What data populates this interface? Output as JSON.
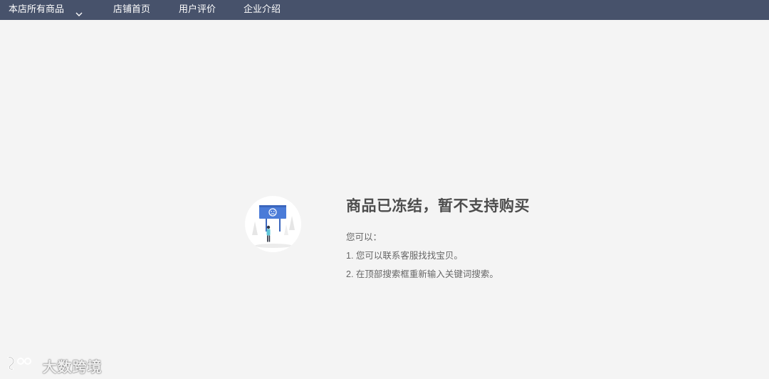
{
  "nav": {
    "all_products": "本店所有商品",
    "store_home": "店铺首页",
    "user_reviews": "用户评价",
    "company_intro": "企业介绍"
  },
  "message": {
    "title": "商品已冻结，暂不支持购买",
    "hint": "您可以：",
    "suggestion_1": "1. 您可以联系客服找找宝贝。",
    "suggestion_2": "2. 在顶部搜索框重新输入关键词搜索。"
  },
  "watermark": {
    "text": "大数跨境",
    "logo_text": "100"
  },
  "colors": {
    "nav_bg": "#47526b",
    "page_bg": "#f4f4f4",
    "title": "#4d4d4d",
    "body_text": "#666666",
    "billboard": "#4a7bd8"
  },
  "icons": {
    "dropdown": "chevron-down-icon",
    "illustration": "frozen-product-illustration"
  }
}
